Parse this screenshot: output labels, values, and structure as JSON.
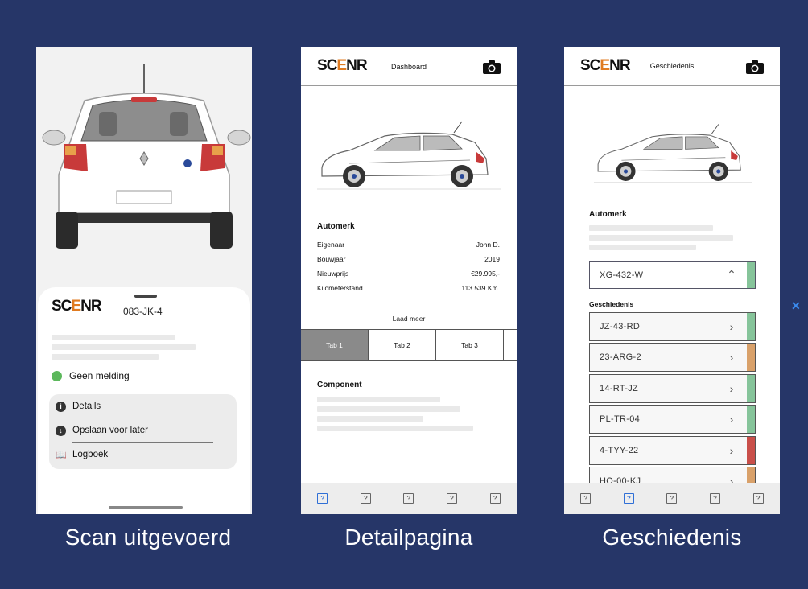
{
  "colors": {
    "background": "#263668",
    "status_ok": "#5cb85c",
    "green_strip": "#86c49a",
    "orange_strip": "#d9a16a",
    "red_strip": "#c94f4a",
    "active_tab": "#8a8a8a",
    "active_nav": "#2f6fd6"
  },
  "brand": {
    "logo_left": "SC",
    "logo_e": "E",
    "logo_right": "NR"
  },
  "captions": [
    "Scan uitgevoerd",
    "Detailpagina",
    "Geschiedenis"
  ],
  "scan": {
    "plate": "083-JK-4",
    "status": "Geen melding",
    "menu": [
      {
        "label": "Details",
        "icon": "info-icon"
      },
      {
        "label": "Opslaan voor later",
        "icon": "download-icon"
      },
      {
        "label": "Logboek",
        "icon": "book-icon"
      }
    ]
  },
  "detail": {
    "title": "Dashboard",
    "section": "Automerk",
    "rows": [
      {
        "key": "Eigenaar",
        "value": "John D."
      },
      {
        "key": "Bouwjaar",
        "value": "2019"
      },
      {
        "key": "Nieuwprijs",
        "value": "€29.995,-"
      },
      {
        "key": "Kilometerstand",
        "value": "113.539 Km."
      }
    ],
    "load_more": "Laad meer",
    "tabs": [
      "Tab 1",
      "Tab 2",
      "Tab 3"
    ],
    "component_title": "Component",
    "nav_icons": [
      "?",
      "?",
      "?",
      "?",
      "?"
    ]
  },
  "history": {
    "title": "Geschiedenis",
    "section": "Automerk",
    "selected_plate": "XG-432-W",
    "list_label": "Geschiedenis",
    "items": [
      {
        "plate": "JZ-43-RD",
        "status": "green"
      },
      {
        "plate": "23-ARG-2",
        "status": "orange"
      },
      {
        "plate": "14-RT-JZ",
        "status": "green"
      },
      {
        "plate": "PL-TR-04",
        "status": "green"
      },
      {
        "plate": "4-TYY-22",
        "status": "red"
      },
      {
        "plate": "HQ-00-KJ",
        "status": "orange"
      }
    ],
    "nav_icons": [
      "?",
      "?",
      "?",
      "?",
      "?"
    ]
  }
}
